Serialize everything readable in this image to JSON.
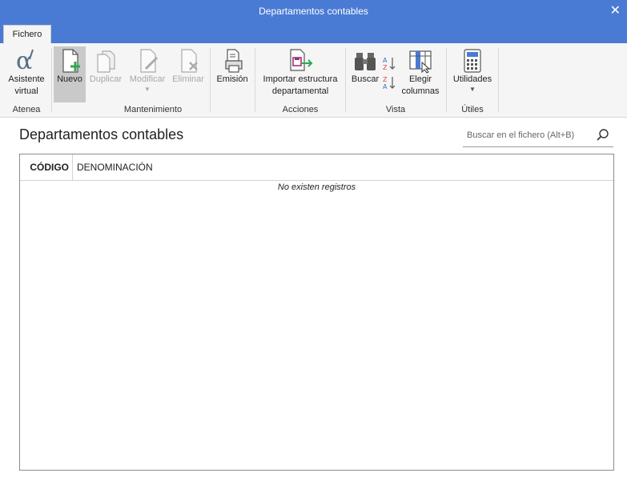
{
  "window": {
    "title": "Departamentos contables",
    "close_glyph": "✕"
  },
  "tab": {
    "label": "Fichero"
  },
  "ribbon": {
    "buttons": {
      "asistente": {
        "label1": "Asistente",
        "label2": "virtual",
        "icon": "alpha-icon"
      },
      "nuevo": {
        "label": "Nuevo",
        "icon": "new-document-icon"
      },
      "duplicar": {
        "label": "Duplicar",
        "icon": "duplicate-icon"
      },
      "modificar": {
        "label": "Modificar",
        "icon": "edit-document-icon"
      },
      "eliminar": {
        "label": "Eliminar",
        "icon": "delete-document-icon"
      },
      "emision": {
        "label": "Emisión",
        "icon": "printer-icon"
      },
      "importar": {
        "label1": "Importar estructura",
        "label2": "departamental",
        "icon": "import-icon"
      },
      "buscar": {
        "label": "Buscar",
        "icon": "binoculars-icon"
      },
      "elegir": {
        "label1": "Elegir",
        "label2": "columnas",
        "icon": "columns-icon"
      },
      "utilidades": {
        "label": "Utilidades",
        "icon": "calculator-icon"
      }
    },
    "groups": {
      "atenea": "Atenea",
      "mantenimiento": "Mantenimiento",
      "acciones": "Acciones",
      "vista": "Vista",
      "utiles": "Útiles"
    },
    "sort": {
      "az": "A Z",
      "za": "Z A"
    }
  },
  "main": {
    "title": "Departamentos contables",
    "search_placeholder": "Buscar en el fichero (Alt+B)"
  },
  "table": {
    "columns": [
      "CÓDIGO",
      "DENOMINACIÓN"
    ],
    "rows": [],
    "empty_message": "No existen registros"
  },
  "colors": {
    "accent": "#4a7bd4",
    "ribbon_bg": "#f5f5f5"
  }
}
